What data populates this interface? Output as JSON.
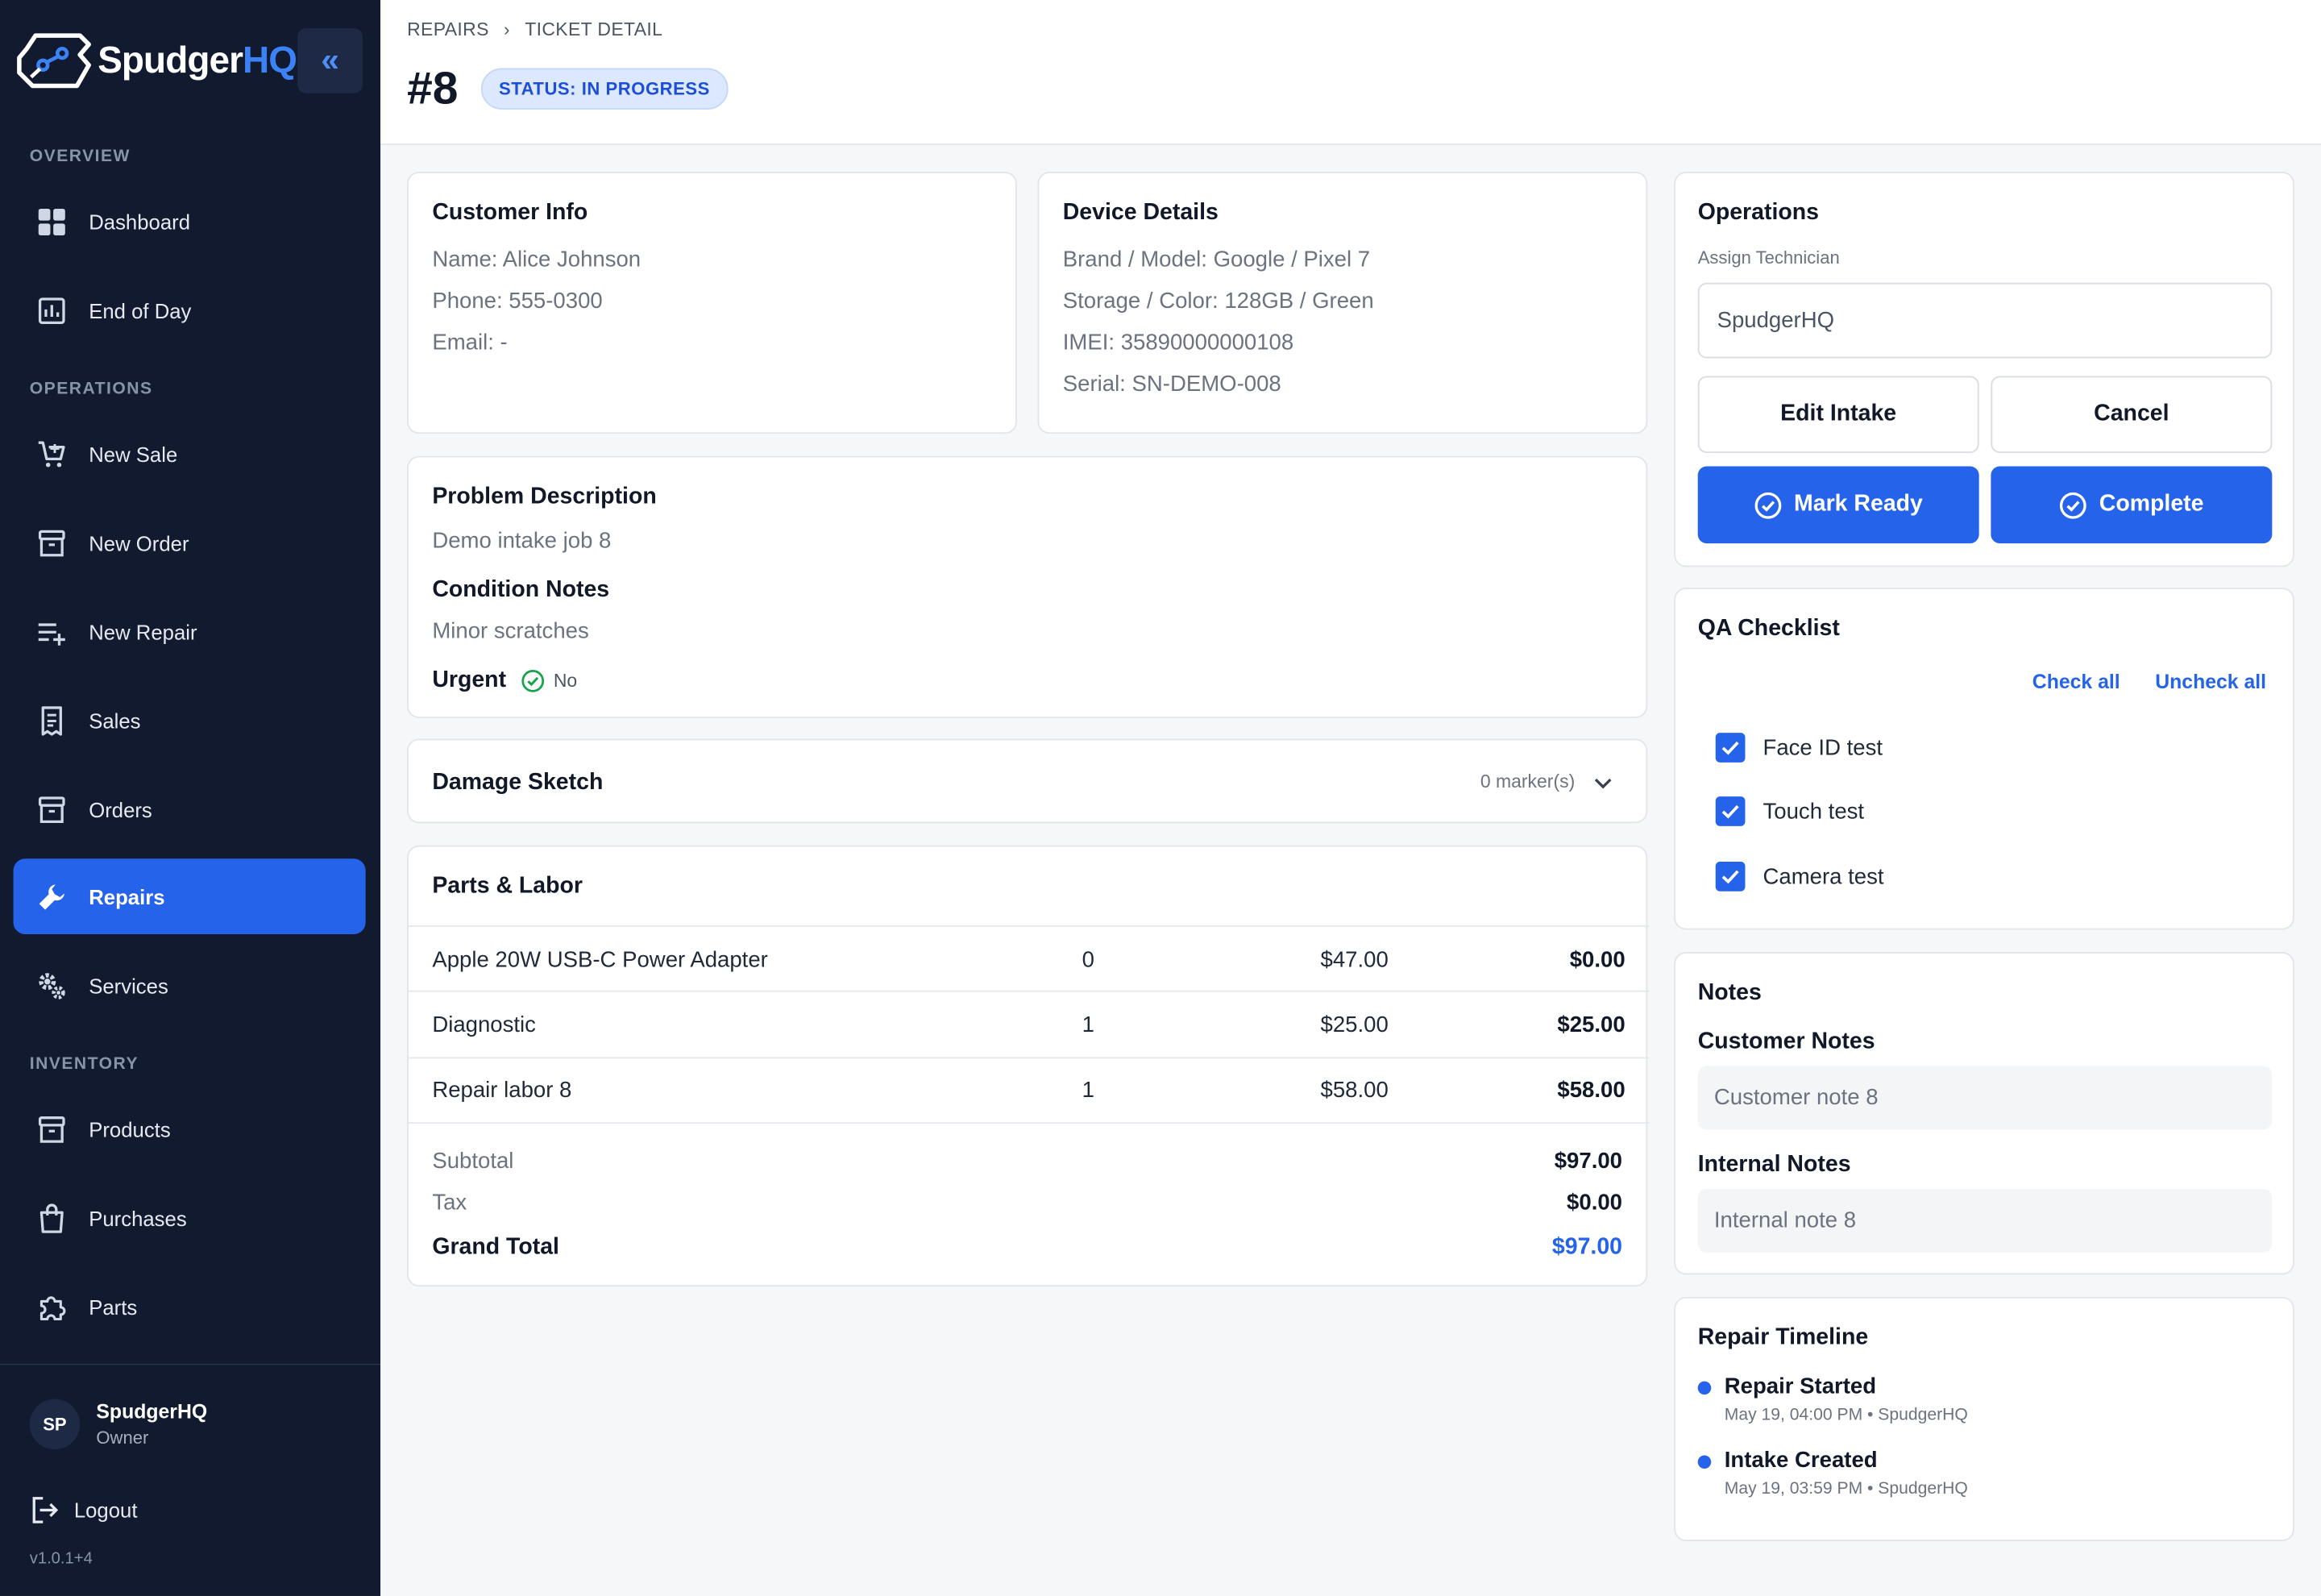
{
  "brand": {
    "name_main": "Spudger",
    "name_accent": "HQ"
  },
  "sidebar": {
    "sections": {
      "overview": "OVERVIEW",
      "operations": "OPERATIONS",
      "inventory": "INVENTORY"
    },
    "items": [
      {
        "label": "Dashboard",
        "icon": "dashboard-icon"
      },
      {
        "label": "End of Day",
        "icon": "bar-chart-icon"
      },
      {
        "label": "New Sale",
        "icon": "cart-plus-icon"
      },
      {
        "label": "New Order",
        "icon": "archive-box-icon"
      },
      {
        "label": "New Repair",
        "icon": "list-plus-icon"
      },
      {
        "label": "Sales",
        "icon": "receipt-icon"
      },
      {
        "label": "Orders",
        "icon": "archive-box-icon"
      },
      {
        "label": "Repairs",
        "icon": "wrench-icon",
        "active": true
      },
      {
        "label": "Services",
        "icon": "gears-icon"
      },
      {
        "label": "Products",
        "icon": "archive-box-icon"
      },
      {
        "label": "Purchases",
        "icon": "shopping-bag-icon"
      },
      {
        "label": "Parts",
        "icon": "puzzle-icon"
      }
    ],
    "user": {
      "initials": "SP",
      "name": "SpudgerHQ",
      "role": "Owner"
    },
    "logout_label": "Logout",
    "version": "v1.0.1+4"
  },
  "header": {
    "breadcrumb": [
      "REPAIRS",
      "TICKET DETAIL"
    ],
    "ticket": "#8",
    "status": "STATUS: IN PROGRESS"
  },
  "customer": {
    "title": "Customer Info",
    "name": "Name: Alice Johnson",
    "phone": "Phone: 555-0300",
    "email": "Email: -"
  },
  "device": {
    "title": "Device Details",
    "model": "Brand / Model: Google / Pixel 7",
    "storage": "Storage / Color: 128GB / Green",
    "imei": "IMEI: 35890000000108",
    "serial": "Serial: SN-DEMO-008"
  },
  "problem": {
    "title": "Problem Description",
    "text": "Demo intake job 8",
    "condition_title": "Condition Notes",
    "condition_text": "Minor scratches",
    "urgent_label": "Urgent",
    "urgent_value": "No"
  },
  "damage": {
    "title": "Damage Sketch",
    "markers": "0 marker(s)"
  },
  "parts": {
    "title": "Parts & Labor",
    "rows": [
      {
        "name": "Apple 20W USB-C Power Adapter",
        "qty": "0",
        "price": "$47.00",
        "total": "$0.00"
      },
      {
        "name": "Diagnostic",
        "qty": "1",
        "price": "$25.00",
        "total": "$25.00"
      },
      {
        "name": "Repair labor 8",
        "qty": "1",
        "price": "$58.00",
        "total": "$58.00"
      }
    ],
    "subtotal_label": "Subtotal",
    "subtotal": "$97.00",
    "tax_label": "Tax",
    "tax": "$0.00",
    "grand_label": "Grand Total",
    "grand": "$97.00"
  },
  "operations": {
    "title": "Operations",
    "assign_label": "Assign Technician",
    "assign_value": "SpudgerHQ",
    "edit_label": "Edit Intake",
    "cancel_label": "Cancel",
    "mark_ready_label": "Mark Ready",
    "complete_label": "Complete"
  },
  "qa": {
    "title": "QA Checklist",
    "check_all": "Check all",
    "uncheck_all": "Uncheck all",
    "items": [
      {
        "label": "Face ID test",
        "checked": true
      },
      {
        "label": "Touch test",
        "checked": true
      },
      {
        "label": "Camera test",
        "checked": true
      }
    ]
  },
  "notes": {
    "title": "Notes",
    "customer_title": "Customer Notes",
    "customer_value": "Customer note 8",
    "internal_title": "Internal Notes",
    "internal_value": "Internal note 8"
  },
  "timeline": {
    "title": "Repair Timeline",
    "items": [
      {
        "title": "Repair Started",
        "sub": "May 19, 04:00 PM • SpudgerHQ"
      },
      {
        "title": "Intake Created",
        "sub": "May 19, 03:59 PM • SpudgerHQ"
      }
    ]
  },
  "colors": {
    "accent": "#2563eb",
    "sidebar": "#111a2e",
    "success": "#16a34a"
  }
}
